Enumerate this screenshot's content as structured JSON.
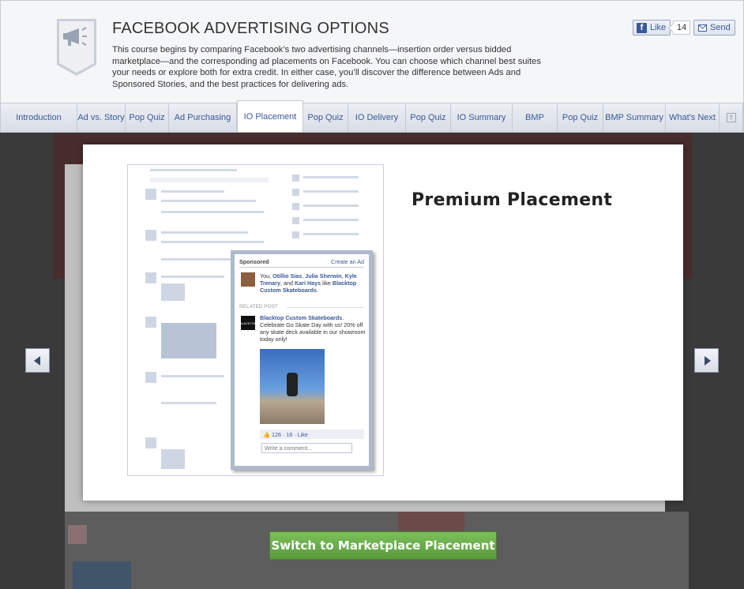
{
  "header": {
    "title": "FACEBOOK ADVERTISING OPTIONS",
    "description": "This course begins by comparing Facebook’s two advertising channels—insertion order versus bidded marketplace—and the corresponding ad placements on Facebook. You can choose which channel best suites your needs or explore both for extra credit. In either case, you’ll discover the difference between Ads and Sponsored Stories, and the best practices for delivering ads.",
    "badge_icon": "megaphone-icon",
    "like_label": "Like",
    "like_count": "14",
    "send_label": "Send"
  },
  "tabs": [
    {
      "label": "Introduction"
    },
    {
      "label": "Ad vs. Story"
    },
    {
      "label": "Pop Quiz"
    },
    {
      "label": "Ad Purchasing"
    },
    {
      "label": "IO Placement",
      "active": true
    },
    {
      "label": "Pop Quiz"
    },
    {
      "label": "IO Delivery"
    },
    {
      "label": "Pop Quiz"
    },
    {
      "label": "IO Summary"
    },
    {
      "label": "BMP"
    },
    {
      "label": "Pop Quiz"
    },
    {
      "label": "BMP Summary"
    },
    {
      "label": "What's Next"
    }
  ],
  "help_icon": "help-icon",
  "modal": {
    "title": "Premium Placement"
  },
  "ad_mock": {
    "sponsored": "Sponsored",
    "create_ad": "Create an Ad",
    "friends_prefix": "You, ",
    "friend1": "Otillio Sias",
    "sep1": ", ",
    "friend2": "Julia Sherwin",
    "sep2": ", ",
    "friend3": "Kyle Trenary",
    "sep3": ", and ",
    "friend4": "Kari Hays",
    "likes_text": " like ",
    "page_name": "Blacktop Custom Skateboards",
    "period": ".",
    "related": "RELATED POST",
    "post_body": " Celebrate Go Skate Day with us! 20% off any skate deck available in our showroom today only!",
    "stats": "126 · 16 · Like",
    "comment_placeholder": "Write a comment...",
    "logo_text": "BLACKTOP"
  },
  "switch_button": "Switch to Marketplace Placement",
  "colors": {
    "brand": "#3b5998",
    "switch_green": "#6aad4a"
  }
}
